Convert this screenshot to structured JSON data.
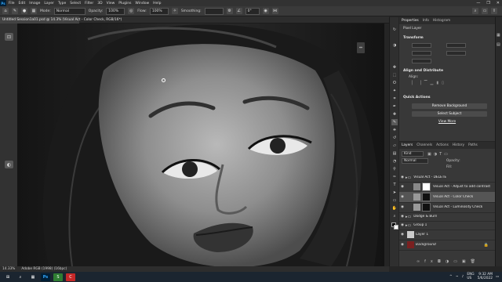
{
  "menu": {
    "items": [
      "File",
      "Edit",
      "Image",
      "Layer",
      "Type",
      "Select",
      "Filter",
      "3D",
      "View",
      "Plugins",
      "Window",
      "Help"
    ],
    "window_controls": [
      "—",
      "❐",
      "✕"
    ]
  },
  "options": {
    "mode_label": "Mode:",
    "mode_value": "Normal",
    "opacity_label": "Opacity:",
    "opacity_value": "100%",
    "flow_label": "Flow:",
    "flow_value": "100%",
    "smoothing_label": "Smoothing:",
    "angle_value": "0°"
  },
  "document": {
    "tab_title": "Untitled Session1a01.psd @ 14.3% (Visual Act - Color Check, RGB/16*)",
    "zoom": "14.33%",
    "doc_info": "Adobe RGB (1998) (16bpc)"
  },
  "properties": {
    "tabs": [
      "Properties",
      "Info",
      "Histogram"
    ],
    "active_tab": "Properties",
    "layer_kind": "Pixel Layer",
    "transform_title": "Transform",
    "align_title": "Align and Distribute",
    "align_sub": "Align:",
    "quick_actions_title": "Quick Actions",
    "buttons": [
      "Remove Background",
      "Select Subject",
      "View More"
    ]
  },
  "layers": {
    "tabs": [
      "Layers",
      "Channels",
      "Actions",
      "History",
      "Paths"
    ],
    "active_tab": "Layers",
    "kind_filter": "Kind",
    "blend_mode": "Normal",
    "opacity_label": "Opacity:",
    "fill_label": "Fill:",
    "rows": [
      {
        "name": "Visual Act - DELETE"
      },
      {
        "name": "Visual Act - Adjust to add contrast"
      },
      {
        "name": "Visual Act - Color Check"
      },
      {
        "name": "Visual Act - Luminosity Check"
      },
      {
        "name": "Dodge & Burn"
      },
      {
        "name": "Group 1"
      },
      {
        "name": "Layer 1"
      },
      {
        "name": "Background"
      }
    ]
  },
  "taskbar": {
    "apps": [
      "⊞",
      "⌕",
      "▦",
      "Ps",
      "S",
      "C"
    ],
    "lang": "ENG",
    "region": "US",
    "time": "9:32 AM",
    "date": "5/6/2022"
  }
}
